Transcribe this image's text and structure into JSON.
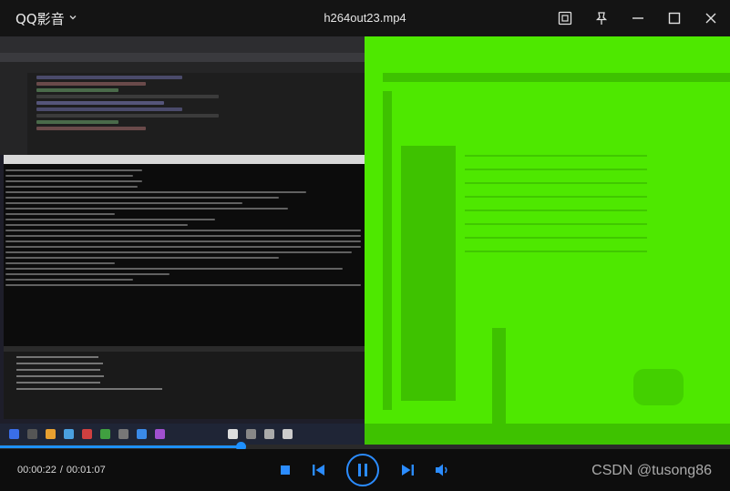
{
  "app": {
    "brand": "QQ影音",
    "title": "h264out23.mp4"
  },
  "icons": {
    "brand_menu": "chevron-down-icon",
    "screenshot": "screenshot-icon",
    "pin": "pin-icon",
    "minimize": "minimize-icon",
    "maximize": "maximize-icon",
    "close": "close-icon",
    "stop": "stop-icon",
    "previous": "previous-icon",
    "pause": "pause-icon",
    "next": "next-icon",
    "volume": "volume-icon"
  },
  "playback": {
    "current_time": "00:00:22",
    "separator": "/",
    "total_time": "00:01:07",
    "progress": 0.33
  },
  "watermark": "CSDN @tusong86",
  "colors": {
    "accent": "#1e90ff",
    "green_frame": "#4ee800"
  }
}
